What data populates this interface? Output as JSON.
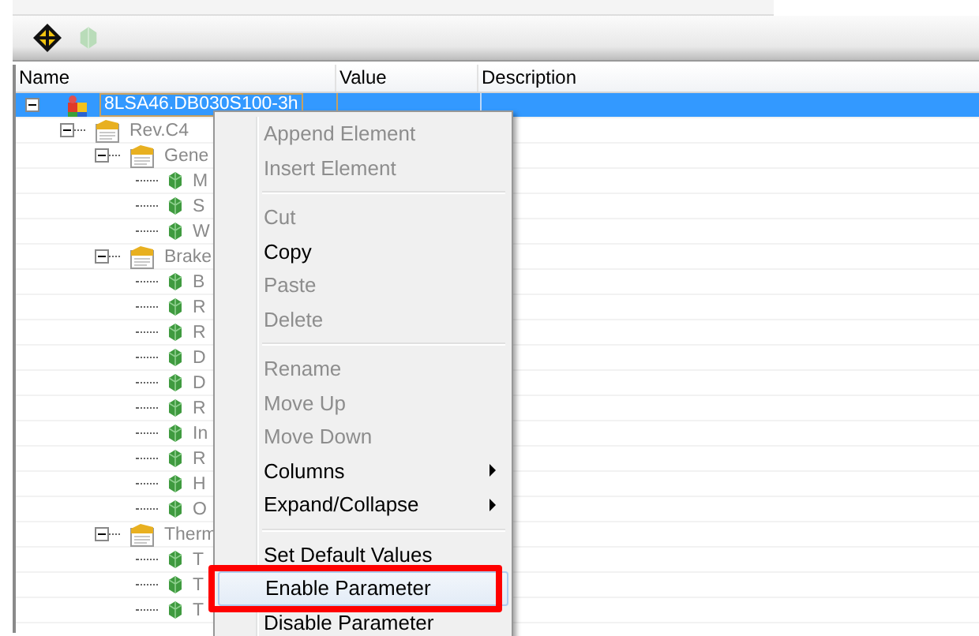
{
  "columns": [
    "Name",
    "Value",
    "Description"
  ],
  "tree": [
    {
      "label": "8LSA46.DB030S100-3h",
      "kind": "device",
      "selected": true,
      "expanded": true,
      "children": [
        {
          "label": "Rev.C4",
          "kind": "folder",
          "selected": false,
          "expanded": true,
          "children": [
            {
              "label": "Gene",
              "kind": "folder",
              "selected": false,
              "expanded": true,
              "children": [
                {
                  "label": "M",
                  "kind": "parameter",
                  "selected": false
                },
                {
                  "label": "S",
                  "kind": "parameter",
                  "selected": false
                },
                {
                  "label": "W",
                  "kind": "parameter",
                  "selected": false
                }
              ]
            },
            {
              "label": "Brake",
              "kind": "folder",
              "selected": false,
              "expanded": true,
              "children": [
                {
                  "label": "B",
                  "kind": "parameter",
                  "selected": false
                },
                {
                  "label": "R",
                  "kind": "parameter",
                  "selected": false
                },
                {
                  "label": "R",
                  "kind": "parameter",
                  "selected": false
                },
                {
                  "label": "D",
                  "kind": "parameter",
                  "selected": false
                },
                {
                  "label": "D",
                  "kind": "parameter",
                  "selected": false
                },
                {
                  "label": "R",
                  "kind": "parameter",
                  "selected": false
                },
                {
                  "label": "In",
                  "kind": "parameter",
                  "selected": false
                },
                {
                  "label": "R",
                  "kind": "parameter",
                  "selected": false
                },
                {
                  "label": "H",
                  "kind": "parameter",
                  "selected": false
                },
                {
                  "label": "O",
                  "kind": "parameter",
                  "selected": false
                }
              ]
            },
            {
              "label": "Therm",
              "kind": "folder",
              "selected": false,
              "expanded": true,
              "children": [
                {
                  "label": "T",
                  "kind": "parameter",
                  "selected": false
                },
                {
                  "label": "T",
                  "kind": "parameter",
                  "selected": false
                },
                {
                  "label": "T",
                  "kind": "parameter",
                  "selected": false
                }
              ]
            }
          ]
        }
      ]
    }
  ],
  "context_menu": [
    {
      "kind": "item",
      "label": "Append Element",
      "disabled": true,
      "highlighted": false,
      "submenu": false,
      "callout": false
    },
    {
      "kind": "item",
      "label": "Insert Element",
      "disabled": true,
      "highlighted": false,
      "submenu": false,
      "callout": false
    },
    {
      "kind": "separator"
    },
    {
      "kind": "item",
      "label": "Cut",
      "disabled": true,
      "highlighted": false,
      "submenu": false,
      "callout": false
    },
    {
      "kind": "item",
      "label": "Copy",
      "disabled": false,
      "highlighted": false,
      "submenu": false,
      "callout": false
    },
    {
      "kind": "item",
      "label": "Paste",
      "disabled": true,
      "highlighted": false,
      "submenu": false,
      "callout": false
    },
    {
      "kind": "item",
      "label": "Delete",
      "disabled": true,
      "highlighted": false,
      "submenu": false,
      "callout": false
    },
    {
      "kind": "separator"
    },
    {
      "kind": "item",
      "label": "Rename",
      "disabled": true,
      "highlighted": false,
      "submenu": false,
      "callout": false
    },
    {
      "kind": "item",
      "label": "Move Up",
      "disabled": true,
      "highlighted": false,
      "submenu": false,
      "callout": false
    },
    {
      "kind": "item",
      "label": "Move Down",
      "disabled": true,
      "highlighted": false,
      "submenu": false,
      "callout": false
    },
    {
      "kind": "item",
      "label": "Columns",
      "disabled": false,
      "highlighted": false,
      "submenu": true,
      "callout": false
    },
    {
      "kind": "item",
      "label": "Expand/Collapse",
      "disabled": false,
      "highlighted": false,
      "submenu": true,
      "callout": false
    },
    {
      "kind": "separator"
    },
    {
      "kind": "item",
      "label": "Set Default Values",
      "disabled": false,
      "highlighted": false,
      "submenu": false,
      "callout": false
    },
    {
      "kind": "item",
      "label": "Enable Parameter",
      "disabled": false,
      "highlighted": true,
      "submenu": false,
      "callout": true
    },
    {
      "kind": "item",
      "label": "Disable Parameter",
      "disabled": false,
      "highlighted": false,
      "submenu": false,
      "callout": false
    }
  ]
}
